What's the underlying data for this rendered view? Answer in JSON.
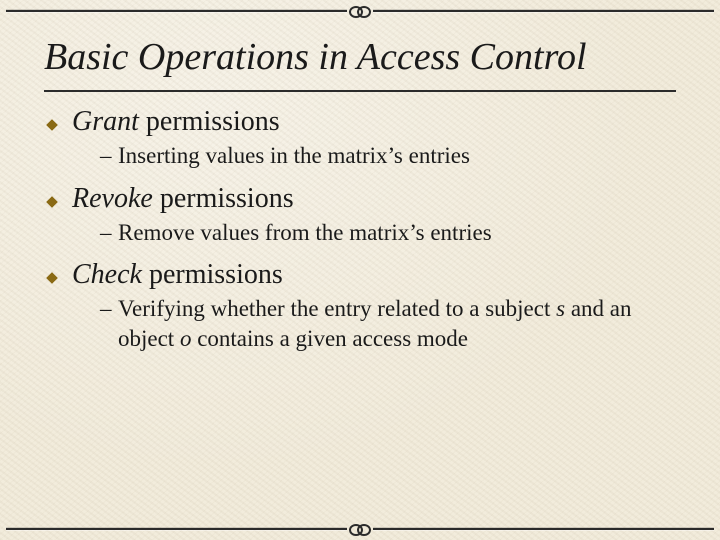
{
  "title": "Basic Operations in Access Control",
  "items": [
    {
      "verb": "Grant",
      "rest": " permissions",
      "sub": "Inserting values in the matrix’s entries"
    },
    {
      "verb": "Revoke",
      "rest": " permissions",
      "sub": "Remove values from the matrix’s entries"
    },
    {
      "verb": "Check",
      "rest": " permissions",
      "sub_pre": "Verifying whether the entry related to a subject ",
      "sub_s": "s",
      "sub_mid": " and an object ",
      "sub_o": "o",
      "sub_post": " contains a given access mode"
    }
  ]
}
